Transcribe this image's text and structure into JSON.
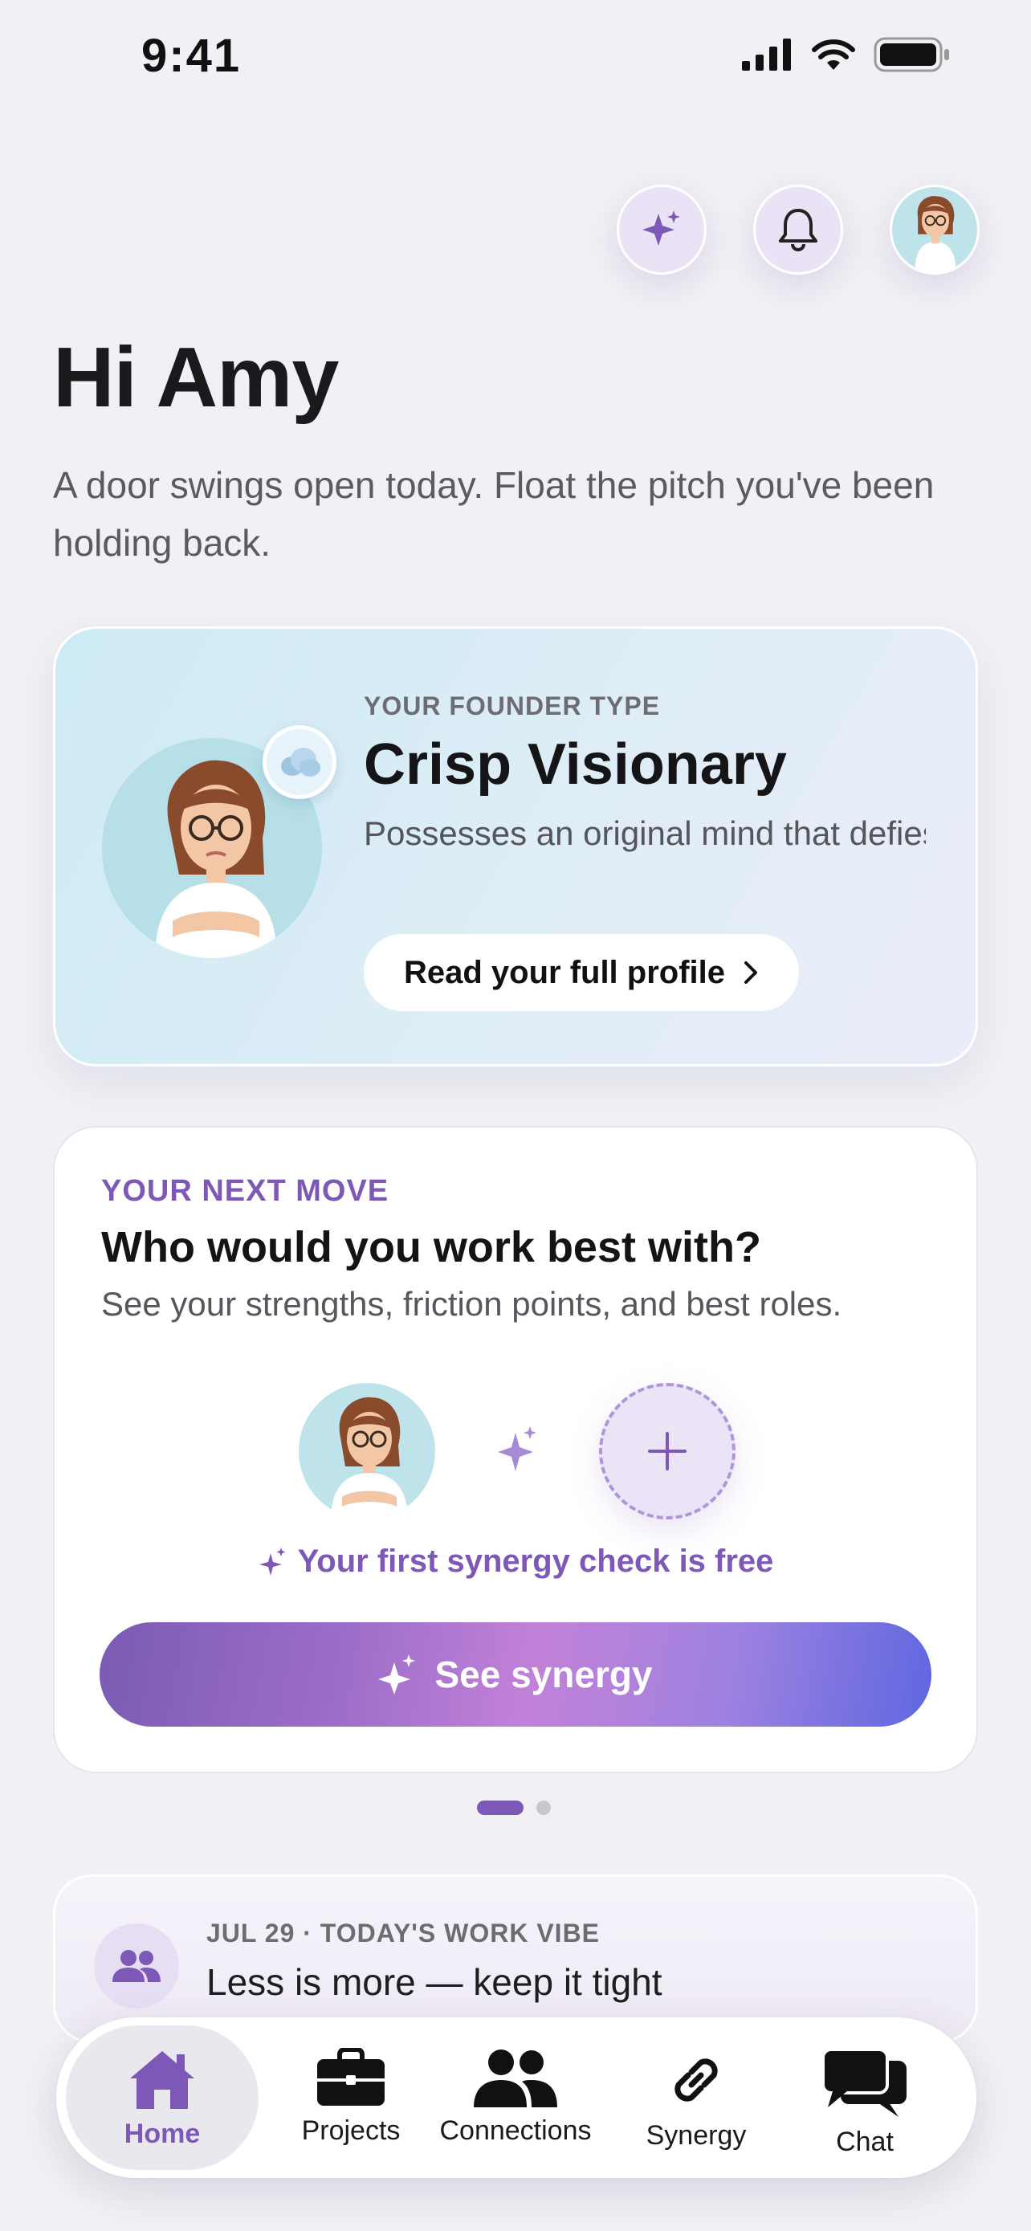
{
  "status_bar": {
    "time": "9:41"
  },
  "header": {
    "greeting": "Hi Amy",
    "subtitle": "A door swings open today. Float the pitch you've been holding back."
  },
  "founder_card": {
    "eyebrow": "YOUR FOUNDER TYPE",
    "type_name": "Crisp Visionary",
    "description": "Possesses an original mind that defies common sense behind h...",
    "cta_label": "Read your full profile"
  },
  "next_move": {
    "eyebrow": "YOUR NEXT MOVE",
    "title": "Who would you work best with?",
    "subtitle": "See your strengths, friction points, and best roles.",
    "free_note": "Your first synergy check is free",
    "cta_label": "See synergy"
  },
  "pager": {
    "count": 2,
    "active": 0
  },
  "vibe": {
    "eyebrow": "JUL 29 · TODAY'S WORK VIBE",
    "text": "Less is more — keep it tight"
  },
  "tabs": [
    {
      "label": "Home",
      "icon": "home-icon",
      "active": true
    },
    {
      "label": "Projects",
      "icon": "briefcase-icon",
      "active": false
    },
    {
      "label": "Connections",
      "icon": "people-icon",
      "active": false
    },
    {
      "label": "Synergy",
      "icon": "link-icon",
      "active": false
    },
    {
      "label": "Chat",
      "icon": "chat-bubbles-icon",
      "active": false
    }
  ],
  "colors": {
    "accent": "#7d58b6",
    "background": "#f1f0f4",
    "founder_card_bg": "#cdeaf4"
  }
}
